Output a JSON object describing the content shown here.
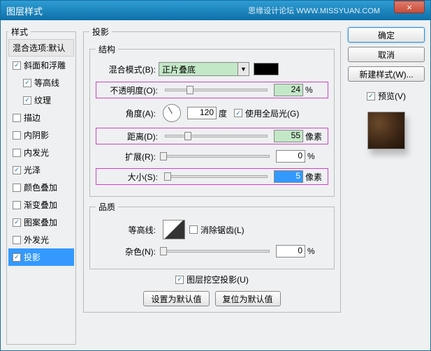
{
  "titlebar": {
    "title": "图层样式",
    "watermark": "思缘设计论坛  WWW.MISSYUAN.COM",
    "close": "×"
  },
  "styles_panel": {
    "legend": "样式",
    "items": [
      {
        "label": "混合选项:默认",
        "header": true
      },
      {
        "label": "斜面和浮雕",
        "checked": true
      },
      {
        "label": "等高线",
        "checked": true,
        "indent": true
      },
      {
        "label": "纹理",
        "checked": true,
        "indent": true
      },
      {
        "label": "描边",
        "checked": false
      },
      {
        "label": "内阴影",
        "checked": false
      },
      {
        "label": "内发光",
        "checked": false
      },
      {
        "label": "光泽",
        "checked": true
      },
      {
        "label": "颜色叠加",
        "checked": false
      },
      {
        "label": "渐变叠加",
        "checked": false
      },
      {
        "label": "图案叠加",
        "checked": true
      },
      {
        "label": "外发光",
        "checked": false
      },
      {
        "label": "投影",
        "checked": true,
        "selected": true
      }
    ]
  },
  "main": {
    "legend": "投影",
    "structure": {
      "legend": "结构",
      "blend_label": "混合模式(B):",
      "blend_value": "正片叠底",
      "opacity_label": "不透明度(O):",
      "opacity_value": "24",
      "opacity_unit": "%",
      "angle_label": "角度(A):",
      "angle_value": "120",
      "angle_unit": "度",
      "global_label": "使用全局光(G)",
      "global_checked": true,
      "distance_label": "距离(D):",
      "distance_value": "55",
      "distance_unit": "像素",
      "spread_label": "扩展(R):",
      "spread_value": "0",
      "spread_unit": "%",
      "size_label": "大小(S):",
      "size_value": "5",
      "size_unit": "像素"
    },
    "quality": {
      "legend": "品质",
      "contour_label": "等高线:",
      "antialias_label": "消除锯齿(L)",
      "antialias_checked": false,
      "noise_label": "杂色(N):",
      "noise_value": "0",
      "noise_unit": "%"
    },
    "knockout_label": "图层挖空投影(U)",
    "knockout_checked": true,
    "btn_default": "设置为默认值",
    "btn_reset": "复位为默认值"
  },
  "right": {
    "ok": "确定",
    "cancel": "取消",
    "new_style": "新建样式(W)...",
    "preview_label": "预览(V)",
    "preview_checked": true
  }
}
